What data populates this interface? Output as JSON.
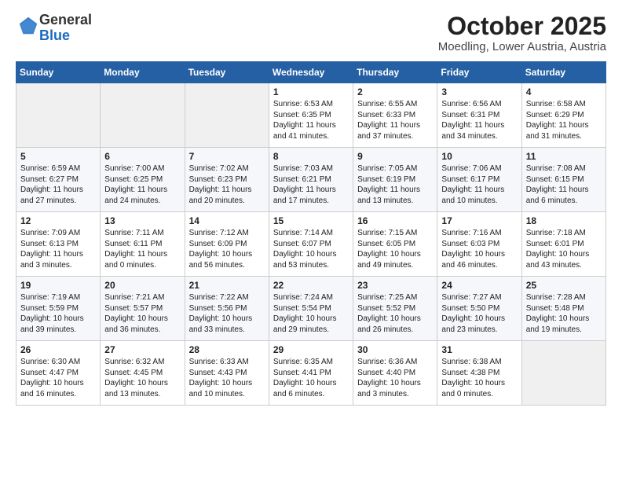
{
  "header": {
    "logo_general": "General",
    "logo_blue": "Blue",
    "title": "October 2025",
    "subtitle": "Moedling, Lower Austria, Austria"
  },
  "days_of_week": [
    "Sunday",
    "Monday",
    "Tuesday",
    "Wednesday",
    "Thursday",
    "Friday",
    "Saturday"
  ],
  "weeks": [
    {
      "cells": [
        {
          "day": "",
          "content": ""
        },
        {
          "day": "",
          "content": ""
        },
        {
          "day": "",
          "content": ""
        },
        {
          "day": "1",
          "content": "Sunrise: 6:53 AM\nSunset: 6:35 PM\nDaylight: 11 hours\nand 41 minutes."
        },
        {
          "day": "2",
          "content": "Sunrise: 6:55 AM\nSunset: 6:33 PM\nDaylight: 11 hours\nand 37 minutes."
        },
        {
          "day": "3",
          "content": "Sunrise: 6:56 AM\nSunset: 6:31 PM\nDaylight: 11 hours\nand 34 minutes."
        },
        {
          "day": "4",
          "content": "Sunrise: 6:58 AM\nSunset: 6:29 PM\nDaylight: 11 hours\nand 31 minutes."
        }
      ]
    },
    {
      "cells": [
        {
          "day": "5",
          "content": "Sunrise: 6:59 AM\nSunset: 6:27 PM\nDaylight: 11 hours\nand 27 minutes."
        },
        {
          "day": "6",
          "content": "Sunrise: 7:00 AM\nSunset: 6:25 PM\nDaylight: 11 hours\nand 24 minutes."
        },
        {
          "day": "7",
          "content": "Sunrise: 7:02 AM\nSunset: 6:23 PM\nDaylight: 11 hours\nand 20 minutes."
        },
        {
          "day": "8",
          "content": "Sunrise: 7:03 AM\nSunset: 6:21 PM\nDaylight: 11 hours\nand 17 minutes."
        },
        {
          "day": "9",
          "content": "Sunrise: 7:05 AM\nSunset: 6:19 PM\nDaylight: 11 hours\nand 13 minutes."
        },
        {
          "day": "10",
          "content": "Sunrise: 7:06 AM\nSunset: 6:17 PM\nDaylight: 11 hours\nand 10 minutes."
        },
        {
          "day": "11",
          "content": "Sunrise: 7:08 AM\nSunset: 6:15 PM\nDaylight: 11 hours\nand 6 minutes."
        }
      ]
    },
    {
      "cells": [
        {
          "day": "12",
          "content": "Sunrise: 7:09 AM\nSunset: 6:13 PM\nDaylight: 11 hours\nand 3 minutes."
        },
        {
          "day": "13",
          "content": "Sunrise: 7:11 AM\nSunset: 6:11 PM\nDaylight: 11 hours\nand 0 minutes."
        },
        {
          "day": "14",
          "content": "Sunrise: 7:12 AM\nSunset: 6:09 PM\nDaylight: 10 hours\nand 56 minutes."
        },
        {
          "day": "15",
          "content": "Sunrise: 7:14 AM\nSunset: 6:07 PM\nDaylight: 10 hours\nand 53 minutes."
        },
        {
          "day": "16",
          "content": "Sunrise: 7:15 AM\nSunset: 6:05 PM\nDaylight: 10 hours\nand 49 minutes."
        },
        {
          "day": "17",
          "content": "Sunrise: 7:16 AM\nSunset: 6:03 PM\nDaylight: 10 hours\nand 46 minutes."
        },
        {
          "day": "18",
          "content": "Sunrise: 7:18 AM\nSunset: 6:01 PM\nDaylight: 10 hours\nand 43 minutes."
        }
      ]
    },
    {
      "cells": [
        {
          "day": "19",
          "content": "Sunrise: 7:19 AM\nSunset: 5:59 PM\nDaylight: 10 hours\nand 39 minutes."
        },
        {
          "day": "20",
          "content": "Sunrise: 7:21 AM\nSunset: 5:57 PM\nDaylight: 10 hours\nand 36 minutes."
        },
        {
          "day": "21",
          "content": "Sunrise: 7:22 AM\nSunset: 5:56 PM\nDaylight: 10 hours\nand 33 minutes."
        },
        {
          "day": "22",
          "content": "Sunrise: 7:24 AM\nSunset: 5:54 PM\nDaylight: 10 hours\nand 29 minutes."
        },
        {
          "day": "23",
          "content": "Sunrise: 7:25 AM\nSunset: 5:52 PM\nDaylight: 10 hours\nand 26 minutes."
        },
        {
          "day": "24",
          "content": "Sunrise: 7:27 AM\nSunset: 5:50 PM\nDaylight: 10 hours\nand 23 minutes."
        },
        {
          "day": "25",
          "content": "Sunrise: 7:28 AM\nSunset: 5:48 PM\nDaylight: 10 hours\nand 19 minutes."
        }
      ]
    },
    {
      "cells": [
        {
          "day": "26",
          "content": "Sunrise: 6:30 AM\nSunset: 4:47 PM\nDaylight: 10 hours\nand 16 minutes."
        },
        {
          "day": "27",
          "content": "Sunrise: 6:32 AM\nSunset: 4:45 PM\nDaylight: 10 hours\nand 13 minutes."
        },
        {
          "day": "28",
          "content": "Sunrise: 6:33 AM\nSunset: 4:43 PM\nDaylight: 10 hours\nand 10 minutes."
        },
        {
          "day": "29",
          "content": "Sunrise: 6:35 AM\nSunset: 4:41 PM\nDaylight: 10 hours\nand 6 minutes."
        },
        {
          "day": "30",
          "content": "Sunrise: 6:36 AM\nSunset: 4:40 PM\nDaylight: 10 hours\nand 3 minutes."
        },
        {
          "day": "31",
          "content": "Sunrise: 6:38 AM\nSunset: 4:38 PM\nDaylight: 10 hours\nand 0 minutes."
        },
        {
          "day": "",
          "content": ""
        }
      ]
    }
  ]
}
